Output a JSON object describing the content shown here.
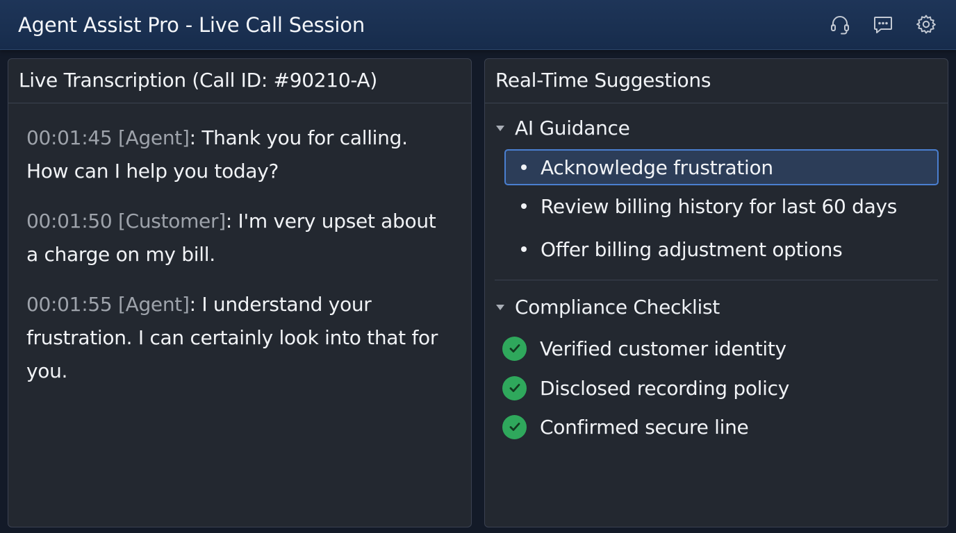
{
  "window": {
    "title": "Agent Assist Pro - Live Call Session",
    "icons": [
      "headset-icon",
      "chat-icon",
      "gear-icon"
    ]
  },
  "transcription": {
    "title": "Live Transcription (Call ID: #90210-A)",
    "entries": [
      {
        "timestamp": "00:01:45",
        "speaker": "[Agent]",
        "text": ": Thank you for calling. How can I help you today?"
      },
      {
        "timestamp": "00:01:50",
        "speaker": "[Customer]",
        "text": ": I'm very upset about a charge on my bill."
      },
      {
        "timestamp": "00:01:55",
        "speaker": "[Agent]",
        "text": ": I understand your frustration. I can certainly look into that for you."
      }
    ]
  },
  "suggestions": {
    "title": "Real-Time Suggestions",
    "guidance": {
      "label": "AI Guidance",
      "items": [
        {
          "label": "Acknowledge frustration",
          "selected": true
        },
        {
          "label": "Review billing history for last 60 days",
          "selected": false
        },
        {
          "label": "Offer billing adjustment options",
          "selected": false
        }
      ]
    },
    "compliance": {
      "label": "Compliance Checklist",
      "items": [
        {
          "label": "Verified customer identity",
          "checked": true
        },
        {
          "label": "Disclosed recording policy",
          "checked": true
        },
        {
          "label": "Confirmed secure line",
          "checked": true
        }
      ]
    }
  },
  "colors": {
    "titlebar": "#1e3558",
    "panel": "#232830",
    "selection_border": "#4a7fd0",
    "check_green": "#2fa85c"
  }
}
